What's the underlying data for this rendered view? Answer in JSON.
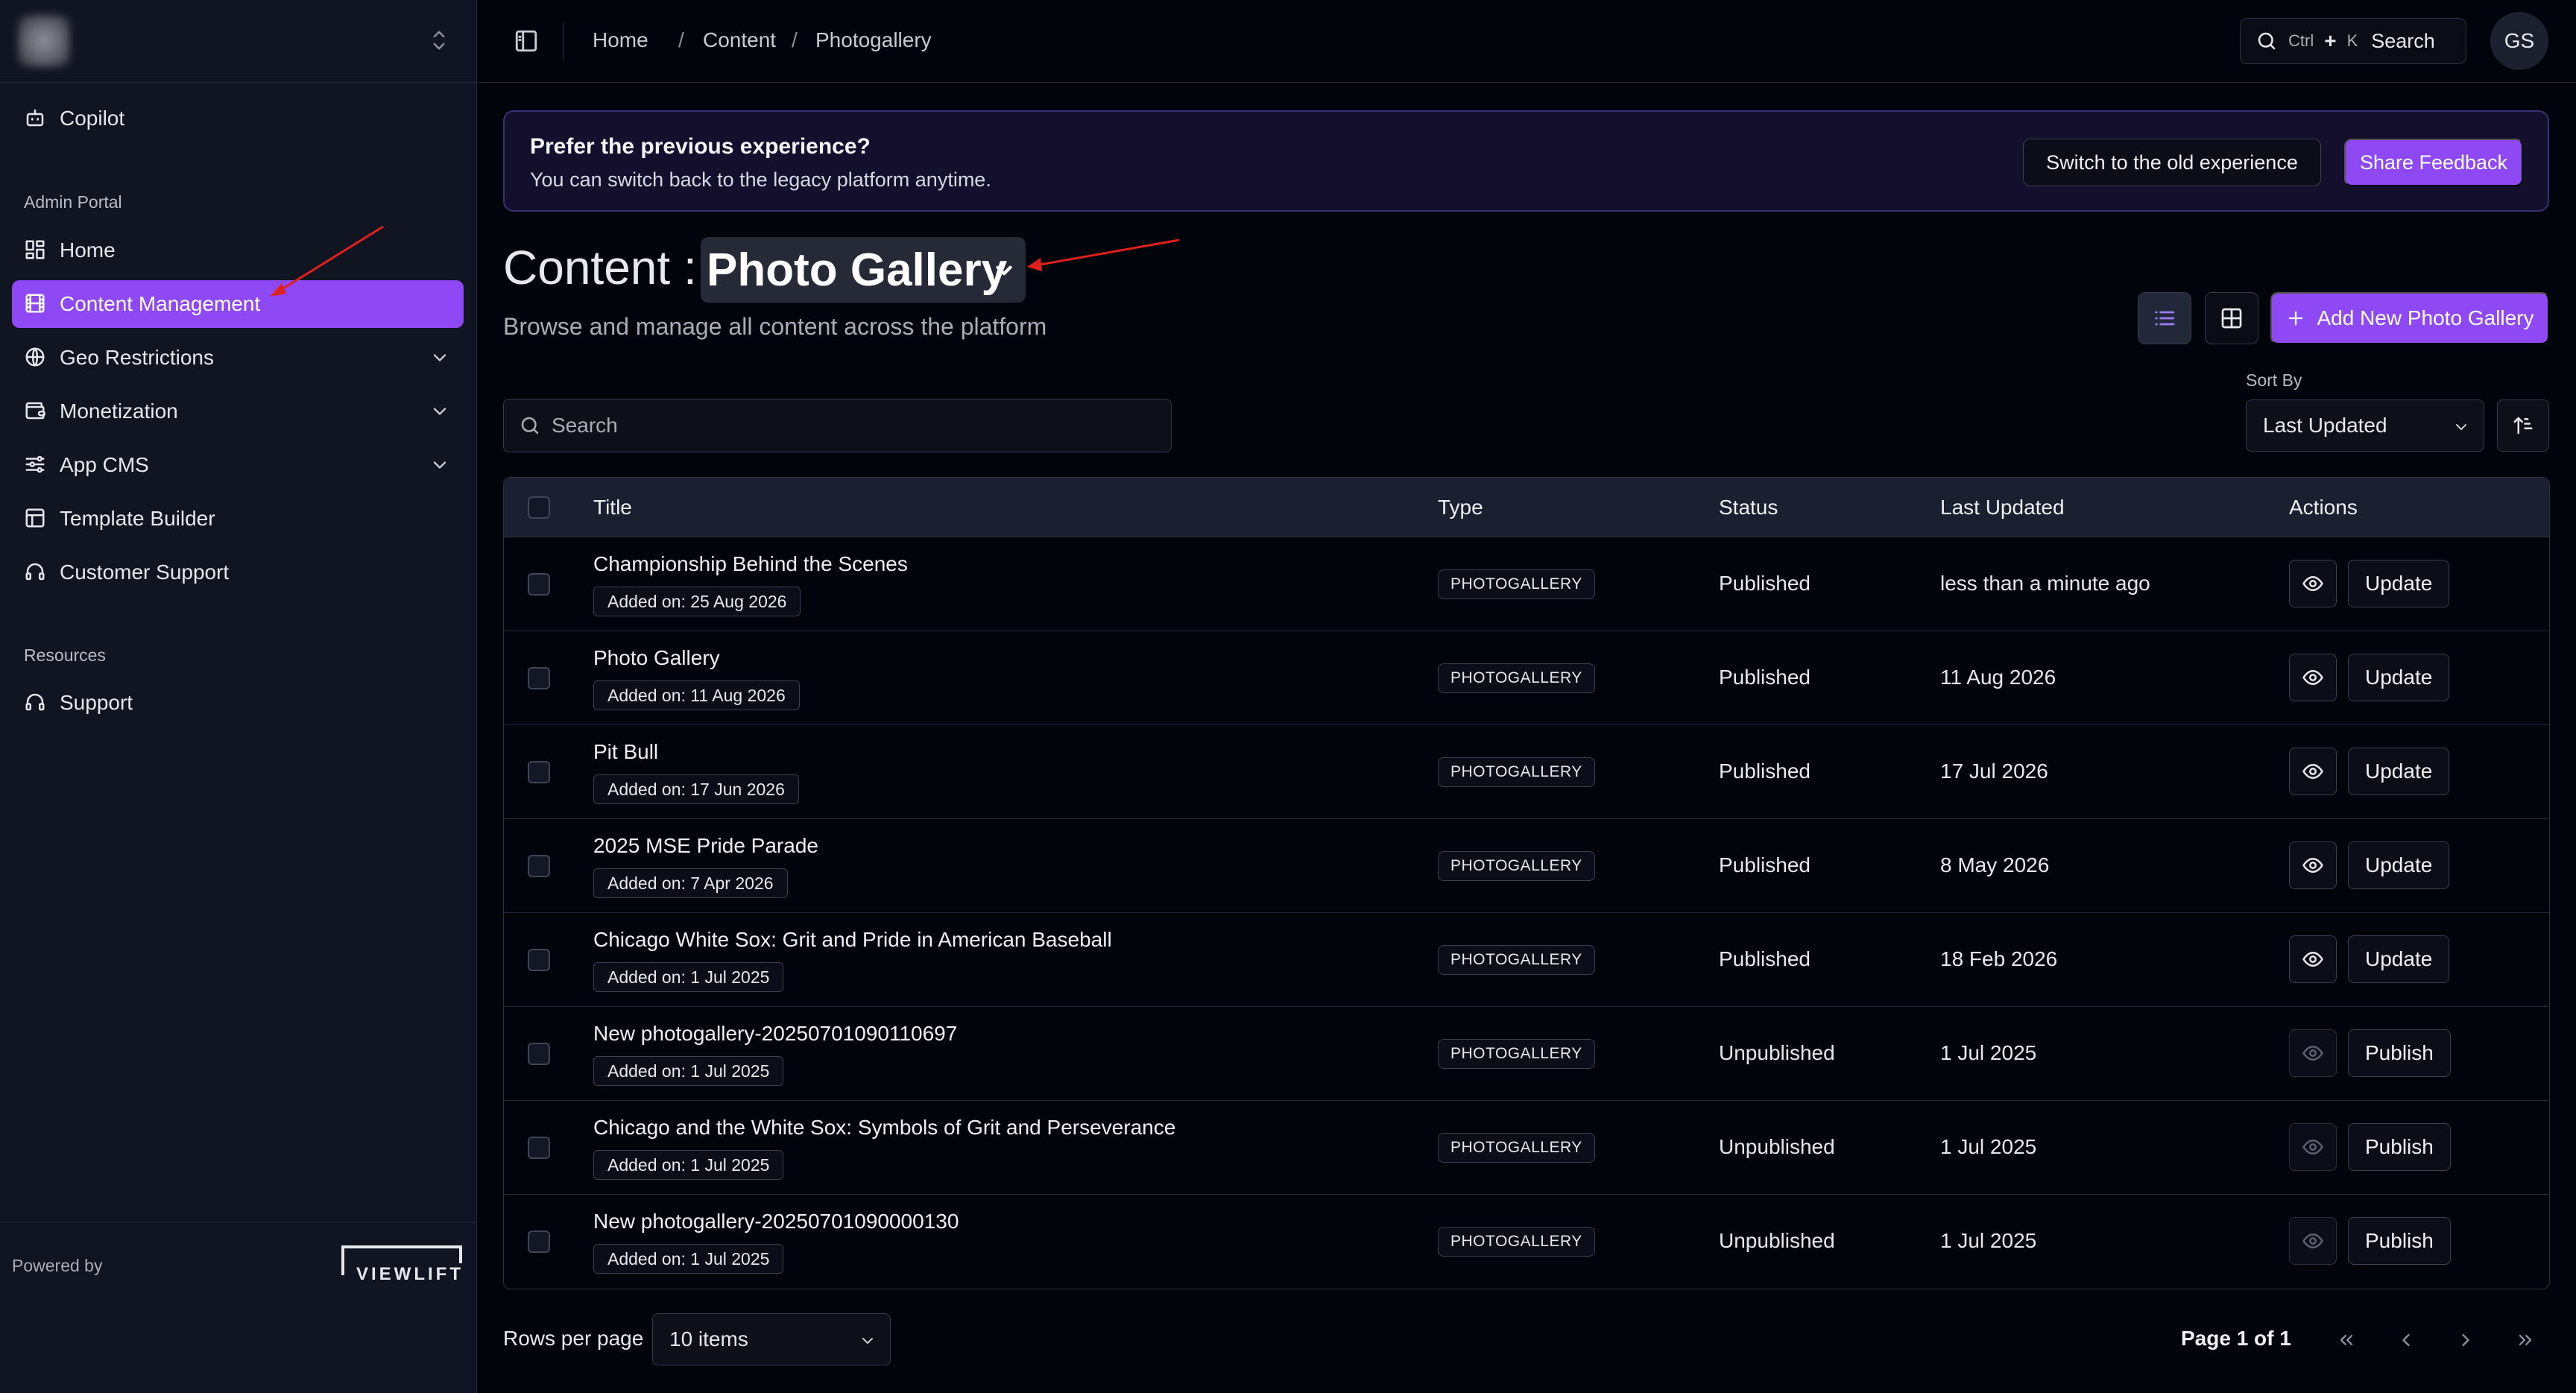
{
  "sidebar": {
    "copilot": "Copilot",
    "group_admin": "Admin Portal",
    "items": [
      {
        "label": "Home",
        "icon": "grid-icon"
      },
      {
        "label": "Content Management",
        "icon": "film-icon"
      },
      {
        "label": "Geo Restrictions",
        "icon": "globe-icon"
      },
      {
        "label": "Monetization",
        "icon": "wallet-icon"
      },
      {
        "label": "App CMS",
        "icon": "sliders-icon"
      },
      {
        "label": "Template Builder",
        "icon": "layout-icon"
      },
      {
        "label": "Customer Support",
        "icon": "headset-icon"
      }
    ],
    "group_resources": "Resources",
    "support": "Support",
    "powered_by": "Powered by",
    "brand": "VIEWLIFT"
  },
  "topbar": {
    "breadcrumb": [
      "Home",
      "Content",
      "Photogallery"
    ],
    "search_key1": "Ctrl",
    "search_plus": "+",
    "search_key2": "K",
    "search_label": "Search",
    "avatar": "GS"
  },
  "banner": {
    "title": "Prefer the previous experience?",
    "text": "You can switch back to the legacy platform anytime.",
    "switch_button": "Switch to the old experience",
    "feedback_button": "Share Feedback"
  },
  "page": {
    "title_prefix": "Content :",
    "content_type": "Photo Gallery",
    "subtitle": "Browse and manage all content across the platform",
    "add_button": "Add New Photo Gallery",
    "search_placeholder": "Search",
    "sort_label": "Sort By",
    "sort_value": "Last Updated"
  },
  "table": {
    "columns": [
      "Title",
      "Type",
      "Status",
      "Last Updated",
      "Actions"
    ],
    "rows": [
      {
        "title": "Championship Behind the Scenes",
        "added": "Added on: 25 Aug 2026",
        "type": "PHOTOGALLERY",
        "status": "Published",
        "updated": "less than a minute ago",
        "action": "Update"
      },
      {
        "title": "Photo Gallery",
        "added": "Added on: 11 Aug 2026",
        "type": "PHOTOGALLERY",
        "status": "Published",
        "updated": "11 Aug 2026",
        "action": "Update"
      },
      {
        "title": "Pit Bull",
        "added": "Added on: 17 Jun 2026",
        "type": "PHOTOGALLERY",
        "status": "Published",
        "updated": "17 Jul 2026",
        "action": "Update"
      },
      {
        "title": "2025 MSE Pride Parade",
        "added": "Added on: 7 Apr 2026",
        "type": "PHOTOGALLERY",
        "status": "Published",
        "updated": "8 May 2026",
        "action": "Update"
      },
      {
        "title": "Chicago White Sox: Grit and Pride in American Baseball",
        "added": "Added on: 1 Jul 2025",
        "type": "PHOTOGALLERY",
        "status": "Published",
        "updated": "18 Feb 2026",
        "action": "Update"
      },
      {
        "title": "New photogallery-20250701090110697",
        "added": "Added on: 1 Jul 2025",
        "type": "PHOTOGALLERY",
        "status": "Unpublished",
        "updated": "1 Jul 2025",
        "action": "Publish"
      },
      {
        "title": "Chicago and the White Sox: Symbols of Grit and Perseverance",
        "added": "Added on: 1 Jul 2025",
        "type": "PHOTOGALLERY",
        "status": "Unpublished",
        "updated": "1 Jul 2025",
        "action": "Publish"
      },
      {
        "title": "New photogallery-20250701090000130",
        "added": "Added on: 1 Jul 2025",
        "type": "PHOTOGALLERY",
        "status": "Unpublished",
        "updated": "1 Jul 2025",
        "action": "Publish"
      }
    ]
  },
  "pagination": {
    "rows_label": "Rows per page",
    "rows_value": "10 items",
    "page_info": "Page 1 of 1"
  },
  "colors": {
    "accent": "#8e49f5",
    "background": "#02040b",
    "sidebar": "#111522",
    "annotation_arrow": "#e0201c"
  }
}
